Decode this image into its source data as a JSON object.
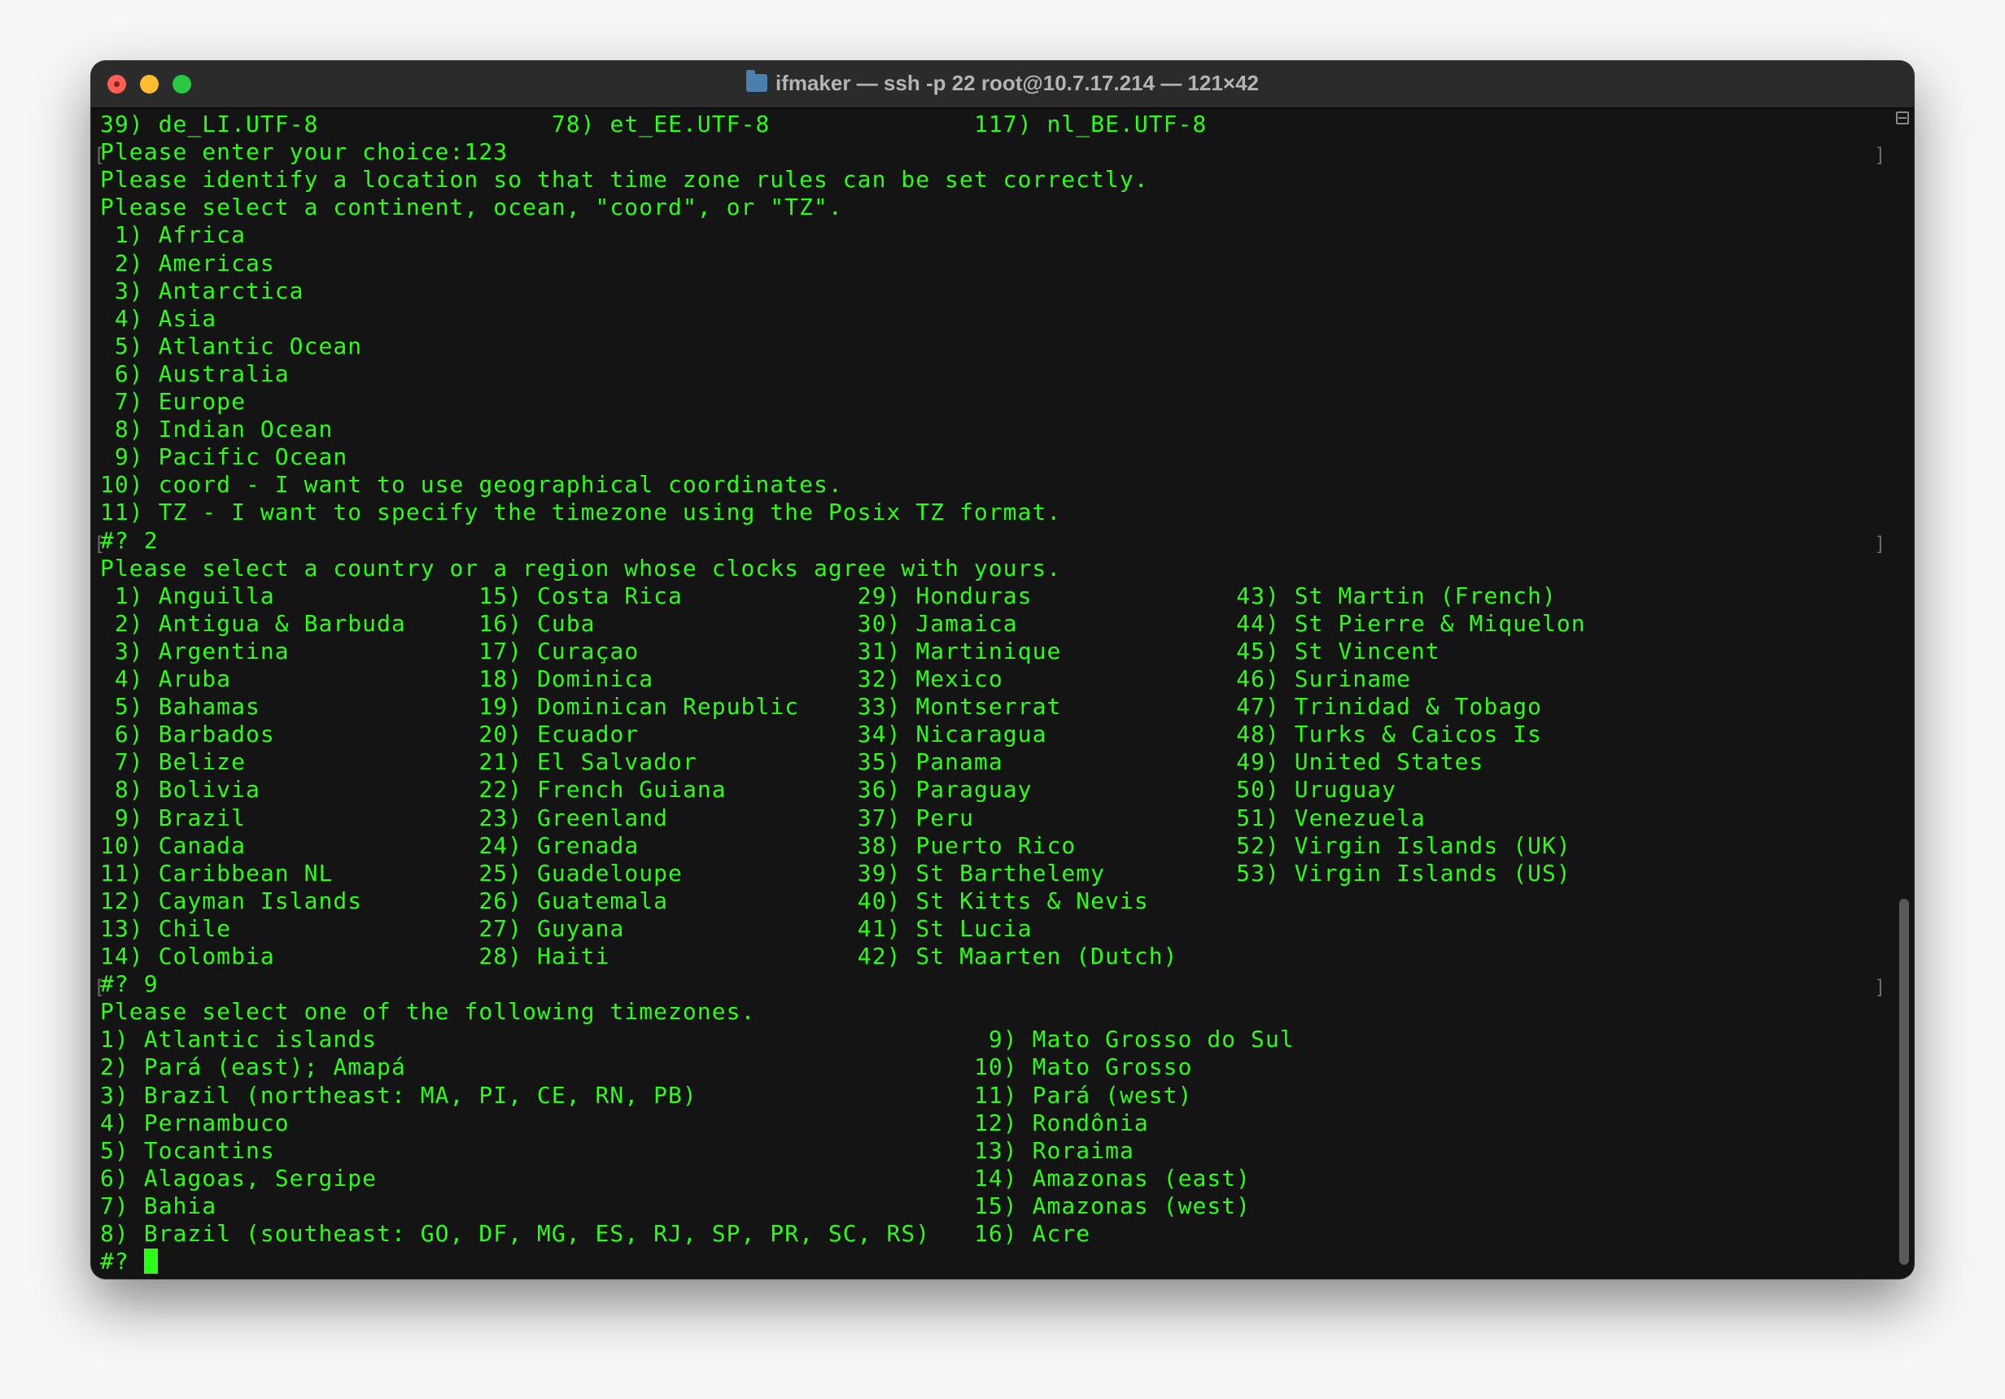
{
  "window": {
    "title": "ifmaker — ssh -p 22 root@10.7.17.214 — 121×42",
    "colors": {
      "text": "#2cfd14",
      "background": "#141414"
    }
  },
  "locale_line": [
    {
      "num": "39)",
      "name": "de_LI.UTF-8"
    },
    {
      "num": "78)",
      "name": "et_EE.UTF-8"
    },
    {
      "num": "117)",
      "name": "nl_BE.UTF-8"
    }
  ],
  "lines": {
    "enter_choice": "Please enter your choice:123",
    "identify": "Please identify a location so that time zone rules can be set correctly.",
    "select_continent": "Please select a continent, ocean, \"coord\", or \"TZ\".",
    "prompt1": "#? 2",
    "select_country": "Please select a country or a region whose clocks agree with yours.",
    "prompt2": "#? 9",
    "select_timezone": "Please select one of the following timezones.",
    "prompt3": "#? "
  },
  "continents": [
    {
      "num": "1)",
      "name": "Africa"
    },
    {
      "num": "2)",
      "name": "Americas"
    },
    {
      "num": "3)",
      "name": "Antarctica"
    },
    {
      "num": "4)",
      "name": "Asia"
    },
    {
      "num": "5)",
      "name": "Atlantic Ocean"
    },
    {
      "num": "6)",
      "name": "Australia"
    },
    {
      "num": "7)",
      "name": "Europe"
    },
    {
      "num": "8)",
      "name": "Indian Ocean"
    },
    {
      "num": "9)",
      "name": "Pacific Ocean"
    },
    {
      "num": "10)",
      "name": "coord - I want to use geographical coordinates."
    },
    {
      "num": "11)",
      "name": "TZ - I want to specify the timezone using the Posix TZ format."
    }
  ],
  "countries": [
    {
      "num": "1)",
      "name": "Anguilla"
    },
    {
      "num": "2)",
      "name": "Antigua & Barbuda"
    },
    {
      "num": "3)",
      "name": "Argentina"
    },
    {
      "num": "4)",
      "name": "Aruba"
    },
    {
      "num": "5)",
      "name": "Bahamas"
    },
    {
      "num": "6)",
      "name": "Barbados"
    },
    {
      "num": "7)",
      "name": "Belize"
    },
    {
      "num": "8)",
      "name": "Bolivia"
    },
    {
      "num": "9)",
      "name": "Brazil"
    },
    {
      "num": "10)",
      "name": "Canada"
    },
    {
      "num": "11)",
      "name": "Caribbean NL"
    },
    {
      "num": "12)",
      "name": "Cayman Islands"
    },
    {
      "num": "13)",
      "name": "Chile"
    },
    {
      "num": "14)",
      "name": "Colombia"
    },
    {
      "num": "15)",
      "name": "Costa Rica"
    },
    {
      "num": "16)",
      "name": "Cuba"
    },
    {
      "num": "17)",
      "name": "Curaçao"
    },
    {
      "num": "18)",
      "name": "Dominica"
    },
    {
      "num": "19)",
      "name": "Dominican Republic"
    },
    {
      "num": "20)",
      "name": "Ecuador"
    },
    {
      "num": "21)",
      "name": "El Salvador"
    },
    {
      "num": "22)",
      "name": "French Guiana"
    },
    {
      "num": "23)",
      "name": "Greenland"
    },
    {
      "num": "24)",
      "name": "Grenada"
    },
    {
      "num": "25)",
      "name": "Guadeloupe"
    },
    {
      "num": "26)",
      "name": "Guatemala"
    },
    {
      "num": "27)",
      "name": "Guyana"
    },
    {
      "num": "28)",
      "name": "Haiti"
    },
    {
      "num": "29)",
      "name": "Honduras"
    },
    {
      "num": "30)",
      "name": "Jamaica"
    },
    {
      "num": "31)",
      "name": "Martinique"
    },
    {
      "num": "32)",
      "name": "Mexico"
    },
    {
      "num": "33)",
      "name": "Montserrat"
    },
    {
      "num": "34)",
      "name": "Nicaragua"
    },
    {
      "num": "35)",
      "name": "Panama"
    },
    {
      "num": "36)",
      "name": "Paraguay"
    },
    {
      "num": "37)",
      "name": "Peru"
    },
    {
      "num": "38)",
      "name": "Puerto Rico"
    },
    {
      "num": "39)",
      "name": "St Barthelemy"
    },
    {
      "num": "40)",
      "name": "St Kitts & Nevis"
    },
    {
      "num": "41)",
      "name": "St Lucia"
    },
    {
      "num": "42)",
      "name": "St Maarten (Dutch)"
    },
    {
      "num": "43)",
      "name": "St Martin (French)"
    },
    {
      "num": "44)",
      "name": "St Pierre & Miquelon"
    },
    {
      "num": "45)",
      "name": "St Vincent"
    },
    {
      "num": "46)",
      "name": "Suriname"
    },
    {
      "num": "47)",
      "name": "Trinidad & Tobago"
    },
    {
      "num": "48)",
      "name": "Turks & Caicos Is"
    },
    {
      "num": "49)",
      "name": "United States"
    },
    {
      "num": "50)",
      "name": "Uruguay"
    },
    {
      "num": "51)",
      "name": "Venezuela"
    },
    {
      "num": "52)",
      "name": "Virgin Islands (UK)"
    },
    {
      "num": "53)",
      "name": "Virgin Islands (US)"
    }
  ],
  "timezones": [
    {
      "num": "1)",
      "name": "Atlantic islands"
    },
    {
      "num": "2)",
      "name": "Pará (east); Amapá"
    },
    {
      "num": "3)",
      "name": "Brazil (northeast: MA, PI, CE, RN, PB)"
    },
    {
      "num": "4)",
      "name": "Pernambuco"
    },
    {
      "num": "5)",
      "name": "Tocantins"
    },
    {
      "num": "6)",
      "name": "Alagoas, Sergipe"
    },
    {
      "num": "7)",
      "name": "Bahia"
    },
    {
      "num": "8)",
      "name": "Brazil (southeast: GO, DF, MG, ES, RJ, SP, PR, SC, RS)"
    },
    {
      "num": "9)",
      "name": "Mato Grosso do Sul"
    },
    {
      "num": "10)",
      "name": "Mato Grosso"
    },
    {
      "num": "11)",
      "name": "Pará (west)"
    },
    {
      "num": "12)",
      "name": "Rondônia"
    },
    {
      "num": "13)",
      "name": "Roraima"
    },
    {
      "num": "14)",
      "name": "Amazonas (east)"
    },
    {
      "num": "15)",
      "name": "Amazonas (west)"
    },
    {
      "num": "16)",
      "name": "Acre"
    }
  ]
}
